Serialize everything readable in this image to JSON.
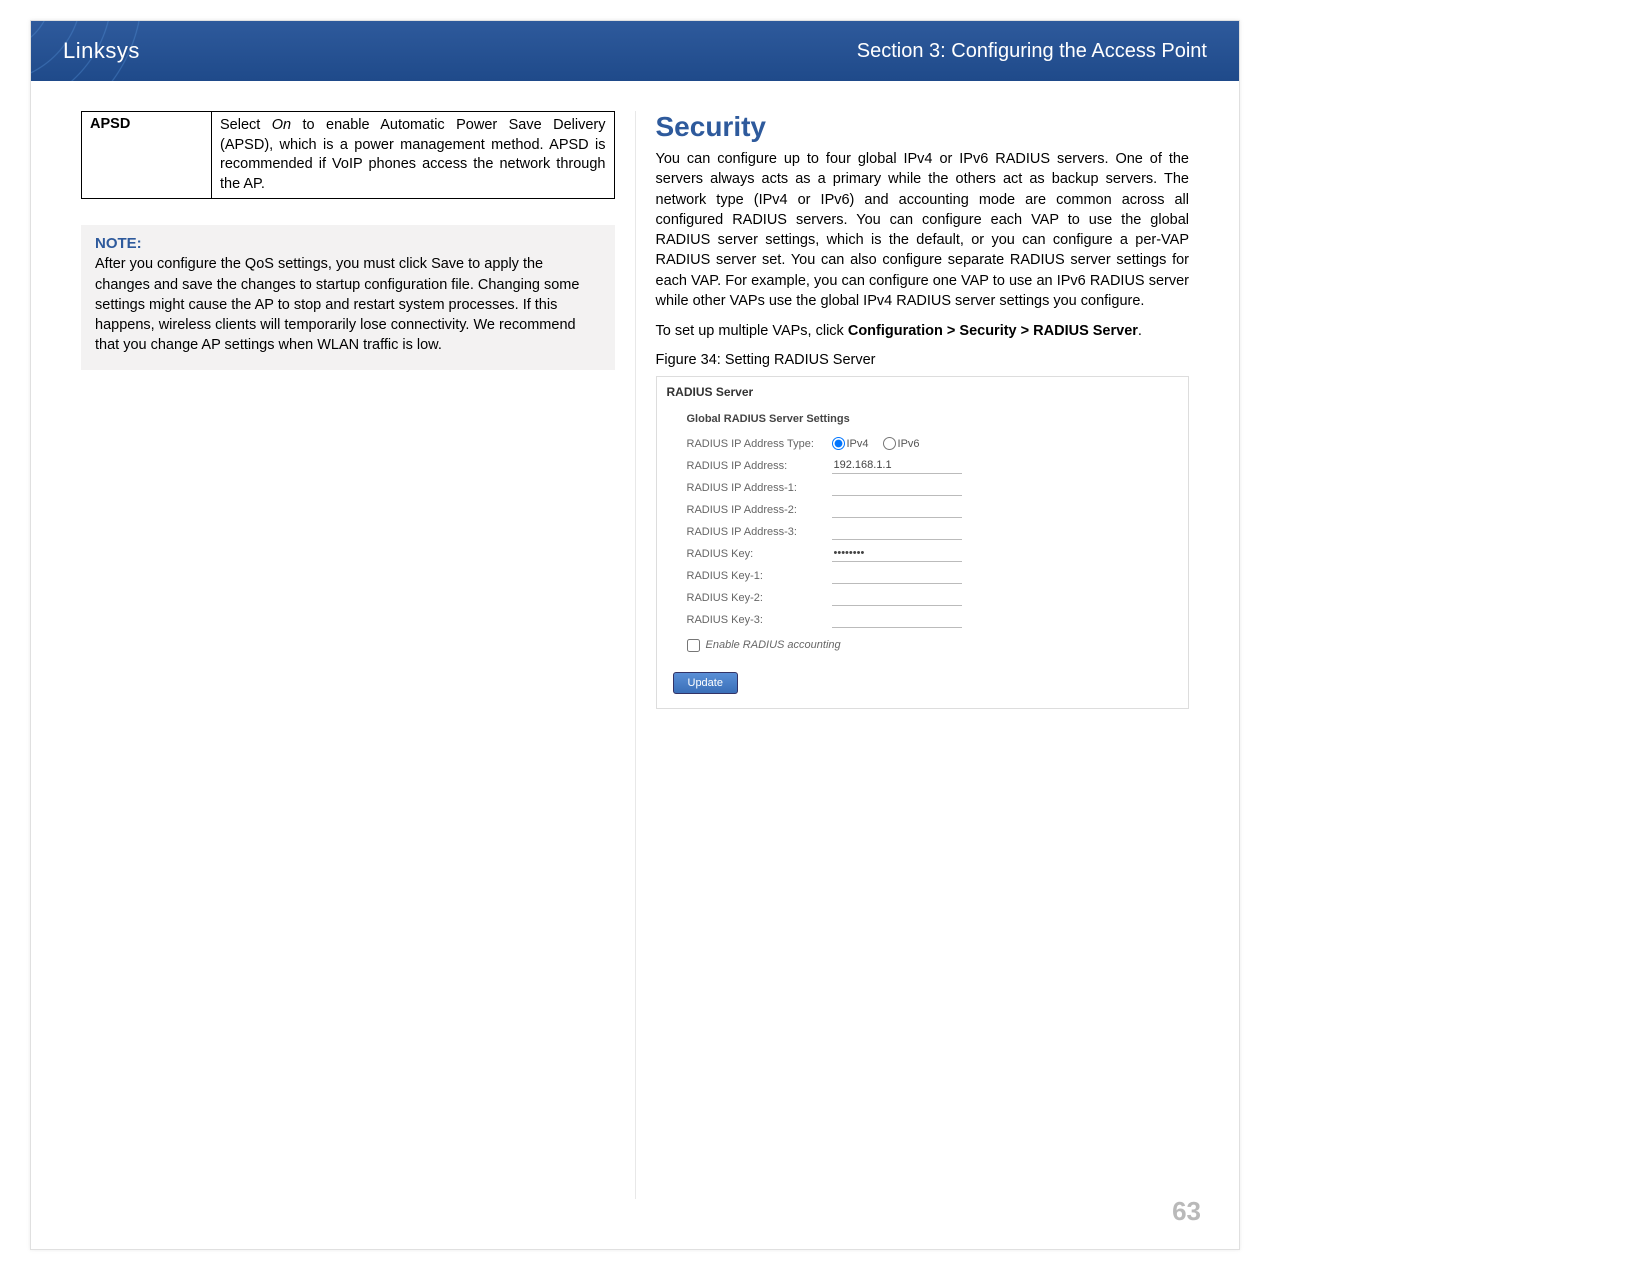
{
  "header": {
    "brand": "Linksys",
    "section": "Section 3:  Configuring the Access Point"
  },
  "left": {
    "apsd": {
      "label": "APSD",
      "desc_prefix": "Select ",
      "desc_em": "On",
      "desc_rest": " to enable Automatic Power Save Delivery (APSD), which is a power management method. APSD is recommended if VoIP phones access the network through the AP."
    },
    "note": {
      "title": "NOTE:",
      "body": "After you configure the QoS settings, you must click Save to apply the changes and save the changes to startup configuration file. Changing some settings might cause the AP to stop and restart system processes. If this happens, wireless clients will temporarily lose connectivity. We recommend that you change AP settings when WLAN traffic is low."
    }
  },
  "right": {
    "heading": "Security",
    "para1": "You can configure up to four global IPv4 or IPv6 RADIUS servers. One of the servers always acts as a primary while the others act as backup servers. The network type (IPv4 or IPv6) and accounting mode are common across all configured RADIUS servers. You can configure each VAP to use the global RADIUS server settings, which is the default, or you can configure a per-VAP RADIUS server set. You can also configure separate RADIUS server settings for each VAP. For example, you can configure one VAP to use an IPv6 RADIUS server while other VAPs use the global IPv4 RADIUS server settings you configure.",
    "para2_prefix": "To set up multiple VAPs, click ",
    "para2_strong": "Configuration > Security > RADIUS Server",
    "para2_suffix": ".",
    "figure_caption": "Figure 34: Setting RADIUS Server",
    "radius": {
      "panel_title": "RADIUS Server",
      "sub_title": "Global RADIUS Server Settings",
      "rows": {
        "type_label": "RADIUS IP Address Type:",
        "ipv4": "IPv4",
        "ipv6": "IPv6",
        "addr": "RADIUS IP Address:",
        "addr_val": "192.168.1.1",
        "addr1": "RADIUS IP Address-1:",
        "addr2": "RADIUS IP Address-2:",
        "addr3": "RADIUS IP Address-3:",
        "key": "RADIUS Key:",
        "key_val": "••••••••",
        "key1": "RADIUS Key-1:",
        "key2": "RADIUS Key-2:",
        "key3": "RADIUS Key-3:",
        "acct": "Enable RADIUS accounting"
      },
      "update_btn": "Update"
    }
  },
  "page_number": "63"
}
